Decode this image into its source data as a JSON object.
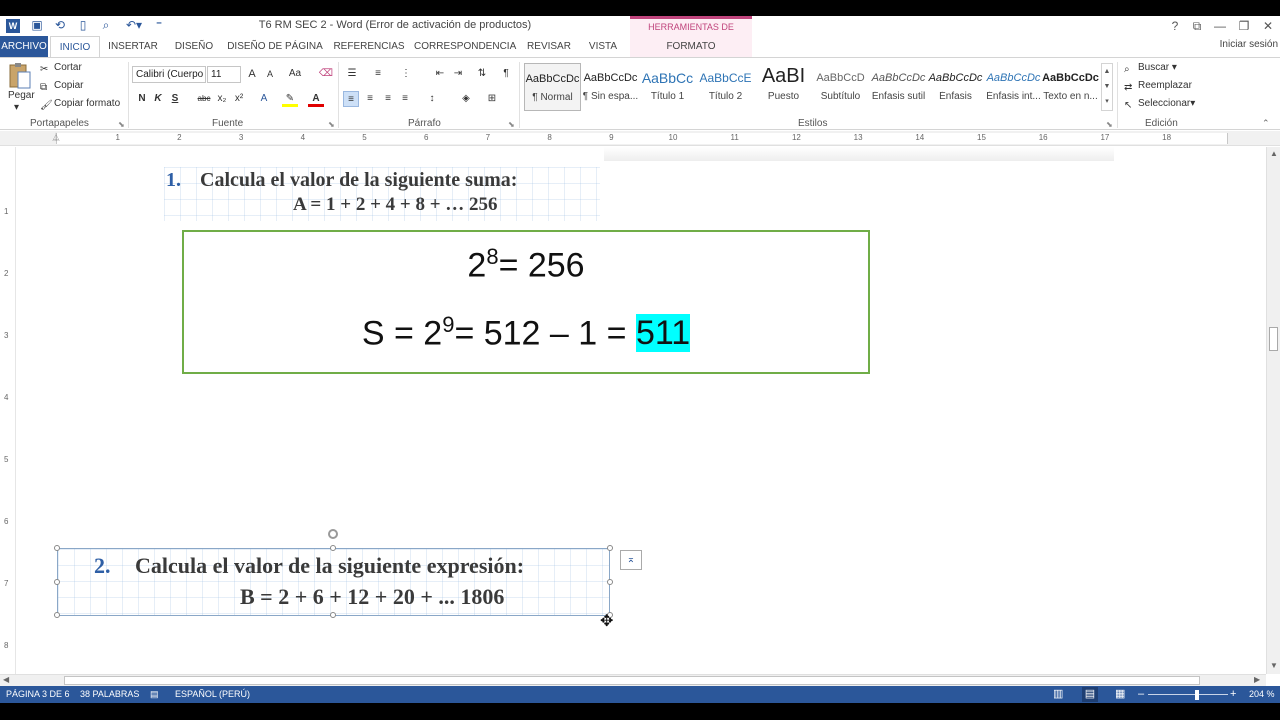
{
  "window": {
    "title": "T6 RM SEC 2 - Word (Error de activación de productos)",
    "context_header": "HERRAMIENTAS DE IMAGEN",
    "buttons": {
      "help": "?",
      "minimize": "—",
      "restore": "❐",
      "close": "✕"
    }
  },
  "tabs": [
    "ARCHIVO",
    "INICIO",
    "INSERTAR",
    "DISEÑO",
    "DISEÑO DE PÁGINA",
    "REFERENCIAS",
    "CORRESPONDENCIA",
    "REVISAR",
    "VISTA",
    "FORMATO"
  ],
  "signin": "Iniciar sesión",
  "ribbon": {
    "clipboard": {
      "paste": "Pegar",
      "cut": "Cortar",
      "copy": "Copiar",
      "format_painter": "Copiar formato",
      "label": "Portapapeles"
    },
    "font": {
      "name": "Calibri (Cuerpo",
      "size": "11",
      "grow": "A",
      "shrink": "A",
      "case": "Aa",
      "bold": "N",
      "italic": "K",
      "underline": "S",
      "strike": "abc",
      "sub": "x₂",
      "sup": "x²",
      "label": "Fuente"
    },
    "paragraph": {
      "label": "Párrafo"
    },
    "styles": {
      "items": [
        {
          "preview": "AaBbCcDc",
          "name": "¶ Normal"
        },
        {
          "preview": "AaBbCcDc",
          "name": "¶ Sin espa..."
        },
        {
          "preview": "AaBbCc",
          "name": "Título 1"
        },
        {
          "preview": "AaBbCcE",
          "name": "Título 2"
        },
        {
          "preview": "AaBI",
          "name": "Puesto"
        },
        {
          "preview": "AaBbCcD",
          "name": "Subtítulo"
        },
        {
          "preview": "AaBbCcDc",
          "name": "Énfasis sutil"
        },
        {
          "preview": "AaBbCcDc",
          "name": "Énfasis"
        },
        {
          "preview": "AaBbCcDc",
          "name": "Énfasis int..."
        },
        {
          "preview": "AaBbCcDc",
          "name": "Texto en n..."
        }
      ],
      "label": "Estilos"
    },
    "editing": {
      "find": "Buscar",
      "replace": "Reemplazar",
      "select": "Seleccionar",
      "label": "Edición"
    }
  },
  "ruler": [
    "1",
    "2",
    "3",
    "4",
    "5",
    "6",
    "7",
    "8",
    "9",
    "10",
    "11",
    "12",
    "13",
    "14",
    "15",
    "16",
    "17",
    "18"
  ],
  "vruler": [
    "1",
    "2",
    "3",
    "4",
    "5",
    "6",
    "7",
    "8"
  ],
  "document": {
    "problem1": {
      "num": "1.",
      "text": "Calcula el valor de la siguiente suma:",
      "expr": "A = 1 + 2 + 4 + 8 + … 256"
    },
    "answer": {
      "line1_base": "2",
      "line1_exp": "8",
      "line1_rest": "= 256",
      "line2_pre": "S = 2",
      "line2_exp": "9",
      "line2_rest": "= 512 – 1 = ",
      "result": "511"
    },
    "problem2": {
      "num": "2.",
      "text": "Calcula el valor de la siguiente expresión:",
      "expr": "B = 2 + 6 + 12 + 20 + ... 1806"
    }
  },
  "status": {
    "page": "PÁGINA 3 DE 6",
    "words": "38 PALABRAS",
    "language": "ESPAÑOL (PERÚ)",
    "zoom": "204 %"
  },
  "colors": {
    "accent": "#2b579a",
    "picture_tools": "#c0447c",
    "box_border": "#70ad47",
    "highlight": "#00ffff"
  }
}
